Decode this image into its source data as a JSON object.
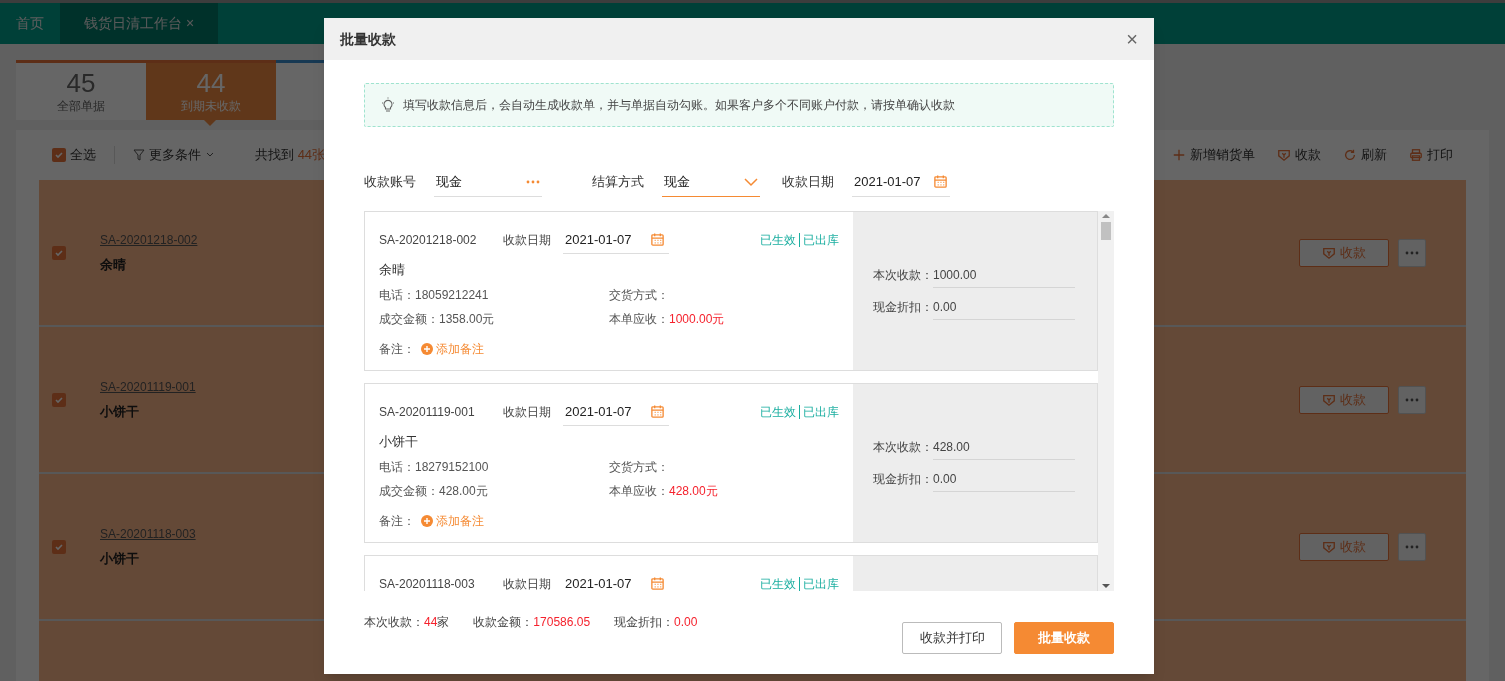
{
  "nav_tabs": [
    {
      "label": "首页",
      "selected": false
    },
    {
      "label": "钱货日清工作台",
      "selected": true,
      "close": "×"
    }
  ],
  "stat_tabs": [
    {
      "count": "45",
      "label": "全部单据",
      "selected": false
    },
    {
      "count": "44",
      "label": "到期未收款",
      "selected": true
    }
  ],
  "toolbar": {
    "select_all": {
      "label": "全选",
      "checked": true
    },
    "filter": "更多条件",
    "found_prefix": "共找到",
    "found_count": "44张",
    "actions": [
      {
        "kind": "add",
        "label": "新增销货单"
      },
      {
        "kind": "receive",
        "label": "收款"
      },
      {
        "kind": "refresh",
        "label": "刷新"
      },
      {
        "kind": "print",
        "label": "打印"
      }
    ]
  },
  "orders": [
    {
      "number": "SA-20201218-002",
      "customer": "余晴",
      "checked": true,
      "action": "收款"
    },
    {
      "number": "SA-20201119-001",
      "customer": "小饼干",
      "checked": true,
      "action": "收款"
    },
    {
      "number": "SA-20201118-003",
      "customer": "小饼干",
      "checked": true,
      "action": "收款"
    }
  ],
  "dialog": {
    "title": "批量收款",
    "close": "×",
    "notice": "填写收款信息后，会自动生成收款单，并与单据自动勾账。如果客户多个不同账户付款，请按单确认收款",
    "form": {
      "account": {
        "label": "收款账号",
        "value": "现金"
      },
      "method": {
        "label": "结算方式",
        "value": "现金"
      },
      "date": {
        "label": "收款日期",
        "value": "2021-01-07"
      }
    },
    "cards": [
      {
        "number": "SA-20201218-002",
        "date_label": "收款日期",
        "date": "2021-01-07",
        "statuses": [
          "已生效",
          "已出库"
        ],
        "customer": "余晴",
        "phone": "电话：18059212241",
        "delivery": "交货方式：",
        "deal": "成交金额：1358.00元",
        "due_label": "本单应收：",
        "due": "1000.00元",
        "note_label": "备注：",
        "add_note": "添加备注",
        "this_label": "本次收款：",
        "this_value": "1000.00",
        "discount_label": "现金折扣：",
        "discount_value": "0.00"
      },
      {
        "number": "SA-20201119-001",
        "date_label": "收款日期",
        "date": "2021-01-07",
        "statuses": [
          "已生效",
          "已出库"
        ],
        "customer": "小饼干",
        "phone": "电话：18279152100",
        "delivery": "交货方式：",
        "deal": "成交金额：428.00元",
        "due_label": "本单应收：",
        "due": "428.00元",
        "note_label": "备注：",
        "add_note": "添加备注",
        "this_label": "本次收款：",
        "this_value": "428.00",
        "discount_label": "现金折扣：",
        "discount_value": "0.00"
      },
      {
        "number": "SA-20201118-003",
        "date_label": "收款日期",
        "date": "2021-01-07",
        "statuses": [
          "已生效",
          "已出库"
        ]
      }
    ],
    "summary": [
      {
        "label": "本次收款：",
        "value": "44",
        "unit": "家"
      },
      {
        "label": "收款金额：",
        "value": "170586.05"
      },
      {
        "label": "现金折扣：",
        "value": "0.00"
      }
    ],
    "buttons": [
      {
        "label": "收款并打印",
        "kind": "secondary"
      },
      {
        "label": "批量收款",
        "kind": "primary"
      }
    ]
  }
}
